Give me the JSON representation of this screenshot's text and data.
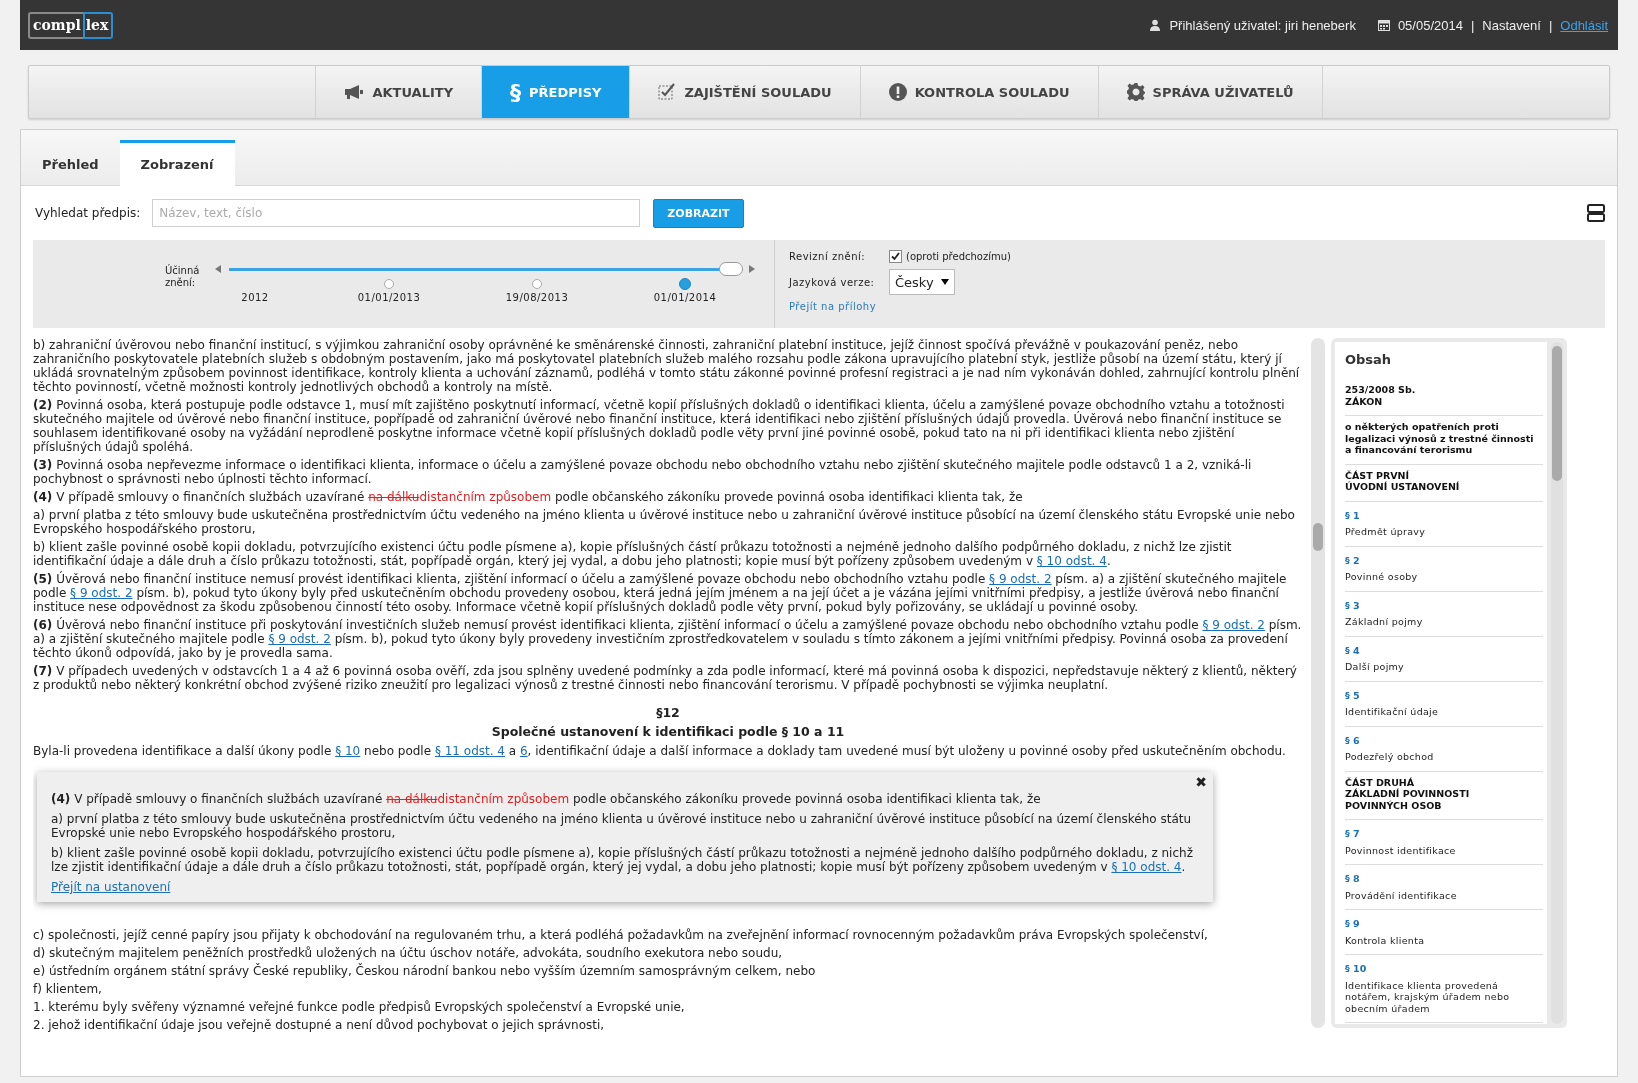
{
  "header": {
    "logo": [
      "compl",
      "lex"
    ],
    "user_label": "Přihlášený uživatel: jiri heneberk",
    "date": "05/05/2014",
    "separator_1": "|",
    "settings": "Nastavení",
    "separator_2": "|",
    "logout": "Odhlásit"
  },
  "nav": [
    {
      "label": "AKTUALITY",
      "kind": "megaphone",
      "selected": false
    },
    {
      "label": "PŘEDPISY",
      "kind": "symbol",
      "symbol": "§",
      "selected": true
    },
    {
      "label": "ZAJIŠTĚNÍ SOULADU",
      "kind": "check",
      "selected": false
    },
    {
      "label": "KONTROLA SOULADU",
      "kind": "alert",
      "selected": false
    },
    {
      "label": "SPRÁVA UŽIVATELŮ",
      "kind": "gear",
      "selected": false
    }
  ],
  "tabs": [
    {
      "label": "Přehled",
      "selected": false
    },
    {
      "label": "Zobrazení",
      "selected": true
    }
  ],
  "search": {
    "label": "Vyhledat předpis:",
    "placeholder": "Název, text, číslo",
    "button": "ZOBRAZIT"
  },
  "timeline": {
    "label": "Účinná znění:",
    "level": 1,
    "points": [
      {
        "label": "2012",
        "kind": "start"
      },
      {
        "label": "01/01/2013",
        "kind": "date",
        "selected": false
      },
      {
        "label": "19/08/2013",
        "kind": "date",
        "selected": false
      },
      {
        "label": "01/01/2014",
        "kind": "date",
        "selected": true
      }
    ]
  },
  "options": {
    "revision_label": "Revizní znění:",
    "revision_checked": true,
    "revision_note": "(oproti předchozímu)",
    "language_label": "Jazyková verze:",
    "language": "Česky",
    "attachments_link": "Přejít na přílohy"
  },
  "document": {
    "upper": [
      {
        "kind": "para",
        "segments": [
          {
            "kind": "text",
            "text": "b) zahraniční úvěrovou nebo finanční institucí, s výjimkou zahraniční osoby oprávněné ke směnárenské činnosti, zahraniční platební instituce, jejíž činnost spočívá převážně v poukazování peněz, nebo zahraničního poskytovatele platebních služeb s obdobným postavením, jako má poskytovatel platebních služeb malého rozsahu podle zákona upravujícího platební styk, jestliže působí na území státu, který jí ukládá srovnatelným způsobem povinnost identifikace, kontroly klienta a uchování záznamů, podléhá v tomto státu zákonné povinné profesní registraci a je nad ním vykonáván dohled, zahrnující kontrolu plnění těchto povinností, včetně možnosti kontroly jednotlivých obchodů a kontroly na místě."
          }
        ]
      },
      {
        "kind": "para",
        "segments": [
          {
            "kind": "text",
            "text": "**(2)** Povinná osoba, která postupuje podle odstavce 1, musí mít zajištěno poskytnutí informací, včetně kopií příslušných dokladů o identifikaci klienta, účelu a zamýšlené povaze obchodního vztahu a totožnosti skutečného majitele od úvěrové nebo finanční instituce, popřípadě od zahraniční úvěrové nebo finanční instituce, která identifikaci nebo zjištění příslušných údajů provedla. Úvěrová nebo finanční instituce se souhlasem identifikované osoby na vyžádání neprodleně poskytne informace včetně kopií příslušných dokladů podle věty první jiné povinné osobě, pokud tato na ni při identifikaci klienta nebo zjištění příslušných údajů spoléhá."
          }
        ]
      },
      {
        "kind": "para",
        "segments": [
          {
            "kind": "text",
            "text": "**(3)** Povinná osoba nepřevezme informace o identifikaci klienta, informace o účelu a zamýšlené povaze obchodu nebo obchodního vztahu nebo zjištění skutečného majitele podle odstavců 1 a 2, vzniká-li pochybnost o správnosti nebo úplnosti těchto informací."
          }
        ]
      },
      {
        "kind": "para",
        "segments": [
          {
            "kind": "text",
            "text": "**(4)** V případě smlouvy o finančních službách uzavírané "
          },
          {
            "kind": "deleted",
            "text": "na dálku"
          },
          {
            "kind": "inserted",
            "text": "distančním způsobem"
          },
          {
            "kind": "text",
            "text": " podle občanského zákoníku provede povinná osoba identifikaci klienta tak, že"
          }
        ]
      },
      {
        "kind": "para",
        "segments": [
          {
            "kind": "text",
            "text": "a) první platba z této smlouvy bude uskutečněna prostřednictvím účtu vedeného na jméno klienta u úvěrové instituce nebo u zahraniční úvěrové instituce působící na území členského státu Evropské unie nebo Evropského hospodářského prostoru,"
          }
        ]
      },
      {
        "kind": "para",
        "segments": [
          {
            "kind": "text",
            "text": "b) klient zašle povinné osobě kopii dokladu, potvrzujícího existenci účtu podle písmene a), kopie příslušných částí průkazu totožnosti a nejméně jednoho dalšího podpůrného dokladu, z nichž lze zjistit identifikační údaje a dále druh a číslo průkazu totožnosti, stát, popřípadě orgán, který jej vydal, a dobu jeho platnosti; kopie musí být pořízeny způsobem uvedeným v "
          },
          {
            "kind": "link",
            "text": "§ 10 odst. 4"
          },
          {
            "kind": "text",
            "text": "."
          }
        ]
      },
      {
        "kind": "para",
        "segments": [
          {
            "kind": "text",
            "text": "**(5)** Úvěrová nebo finanční instituce nemusí provést identifikaci klienta, zjištění informací o účelu a zamýšlené povaze obchodu nebo obchodního vztahu podle "
          },
          {
            "kind": "link",
            "text": "§ 9 odst. 2"
          },
          {
            "kind": "text",
            "text": " písm. a) a zjištění skutečného majitele podle "
          },
          {
            "kind": "link",
            "text": "§ 9 odst. 2"
          },
          {
            "kind": "text",
            "text": " písm. b), pokud tyto úkony byly před uskutečněním obchodu provedeny osobou, která jedná jejím jménem a na její účet a je vázána jejími vnitřními předpisy, a jestliže úvěrová nebo finanční instituce nese odpovědnost za škodu způsobenou činností této osoby. Informace včetně kopií příslušných dokladů podle věty první, pokud byly pořizovány, se ukládají u povinné osoby."
          }
        ]
      },
      {
        "kind": "para",
        "segments": [
          {
            "kind": "text",
            "text": "**(6)** Úvěrová nebo finanční instituce při poskytování investičních služeb nemusí provést identifikaci klienta, zjištění informací o účelu a zamýšlené povaze obchodu nebo obchodního vztahu podle "
          },
          {
            "kind": "link",
            "text": "§ 9 odst. 2"
          },
          {
            "kind": "text",
            "text": " písm. a) a zjištění skutečného majitele podle "
          },
          {
            "kind": "link",
            "text": "§ 9 odst. 2"
          },
          {
            "kind": "text",
            "text": " písm. b), pokud tyto úkony byly provedeny investičním zprostředkovatelem v souladu s tímto zákonem a jejími vnitřními předpisy. Povinná osoba za provedení těchto úkonů odpovídá, jako by je provedla sama."
          }
        ]
      },
      {
        "kind": "para",
        "segments": [
          {
            "kind": "text",
            "text": "**(7)** V případech uvedených v odstavcích 1 a 4 až 6 povinná osoba ověří, zda jsou splněny uvedené podmínky a zda podle informací, které má povinná osoba k dispozici, nepředstavuje některý z klientů, některý z produktů nebo některý konkrétní obchod zvýšené riziko zneužití pro legalizaci výnosů z trestné činnosti nebo financování terorismu. V případě pochybnosti se výjimka neuplatní."
          }
        ]
      },
      {
        "kind": "heading",
        "segments": [
          {
            "kind": "text",
            "text": "§12"
          }
        ]
      },
      {
        "kind": "heading",
        "segments": [
          {
            "kind": "text",
            "text": "Společné ustanovení k identifikaci podle § 10 a 11"
          }
        ]
      },
      {
        "kind": "para",
        "segments": [
          {
            "kind": "text",
            "text": "Byla-li provedena identifikace a další úkony podle "
          },
          {
            "kind": "link",
            "text": "§ 10"
          },
          {
            "kind": "text",
            "text": " nebo podle "
          },
          {
            "kind": "link",
            "text": "§ 11 odst. 4"
          },
          {
            "kind": "text",
            "text": " a "
          },
          {
            "kind": "link",
            "text": "6"
          },
          {
            "kind": "text",
            "text": ", identifikační údaje a další informace a doklady tam uvedené musí být uloženy u povinné osoby před uskutečněním obchodu."
          }
        ]
      }
    ],
    "lower": [
      {
        "segments": [
          {
            "kind": "text",
            "text": "c) společnosti, jejíž cenné papíry jsou přijaty k obchodování na regulovaném trhu, a která podléhá požadavkům na zveřejnění informací rovnocenným požadavkům práva Evropských společenství,"
          }
        ]
      },
      {
        "segments": [
          {
            "kind": "text",
            "text": "d) skutečným majitelem peněžních prostředků uložených na účtu úschov notáře, advokáta, soudního exekutora nebo soudu,"
          }
        ]
      },
      {
        "segments": [
          {
            "kind": "text",
            "text": "e) ústředním orgánem státní správy České republiky, Českou národní bankou nebo vyšším územním samosprávným celkem, nebo"
          }
        ]
      },
      {
        "segments": [
          {
            "kind": "text",
            "text": "f) klientem,"
          }
        ]
      },
      {
        "segments": [
          {
            "kind": "text",
            "text": "1. kterému byly svěřeny významné veřejné funkce podle předpisů Evropských společenství a Evropské unie,"
          }
        ]
      },
      {
        "segments": [
          {
            "kind": "text",
            "text": "2. jehož identifikační údaje jsou veřejně dostupné a není důvod pochybovat o jejich správnosti,"
          }
        ]
      }
    ]
  },
  "popup": {
    "close": "✖",
    "paragraphs": [
      {
        "segments": [
          {
            "kind": "text",
            "text": "**(4)** V případě smlouvy o finančních službách uzavírané "
          },
          {
            "kind": "deleted",
            "text": "na dálku"
          },
          {
            "kind": "inserted",
            "text": "distančním způsobem"
          },
          {
            "kind": "text",
            "text": " podle občanského zákoníku provede povinná osoba identifikaci klienta tak, že"
          }
        ]
      },
      {
        "segments": [
          {
            "kind": "text",
            "text": "a) první platba z této smlouvy bude uskutečněna prostřednictvím účtu vedeného na jméno klienta u úvěrové instituce nebo u zahraniční úvěrové instituce působící na území členského státu Evropské unie nebo Evropského hospodářského prostoru,"
          }
        ]
      },
      {
        "segments": [
          {
            "kind": "text",
            "text": "b) klient zašle povinné osobě kopii dokladu, potvrzujícího existenci účtu podle písmene a), kopie příslušných částí průkazu totožnosti a nejméně jednoho dalšího podpůrného dokladu, z nichž lze zjistit identifikační údaje a dále druh a číslo průkazu totožnosti, stát, popřípadě orgán, který jej vydal, a dobu jeho platnosti; kopie musí být pořízeny způsobem uvedeným v "
          },
          {
            "kind": "link",
            "text": "§ 10 odst. 4"
          },
          {
            "kind": "text",
            "text": "."
          }
        ]
      }
    ],
    "link": "Přejít na ustanovení"
  },
  "toc": {
    "title": "Obsah",
    "items": [
      {
        "kind": "heading",
        "text": "253/2008 Sb.\nZÁKON"
      },
      {
        "kind": "heading",
        "text": "o některých opatřeních proti legalizaci výnosů z trestné činnosti a financování terorismu"
      },
      {
        "kind": "heading",
        "text": "ČÁST PRVNÍ\nÚVODNÍ USTANOVENÍ"
      },
      {
        "kind": "section",
        "number": "§ 1",
        "title": "Předmět úpravy"
      },
      {
        "kind": "section",
        "number": "§ 2",
        "title": "Povinné osoby"
      },
      {
        "kind": "section",
        "number": "§ 3",
        "title": "Základní pojmy"
      },
      {
        "kind": "section",
        "number": "§ 4",
        "title": "Další pojmy"
      },
      {
        "kind": "section",
        "number": "§ 5",
        "title": "Identifikační údaje"
      },
      {
        "kind": "section",
        "number": "§ 6",
        "title": "Podezřelý obchod"
      },
      {
        "kind": "heading",
        "text": "ČÁST DRUHÁ\nZÁKLADNÍ POVINNOSTI\nPOVINNÝCH OSOB"
      },
      {
        "kind": "section",
        "number": "§ 7",
        "title": "Povinnost identifikace"
      },
      {
        "kind": "section",
        "number": "§ 8",
        "title": "Provádění identifikace"
      },
      {
        "kind": "section",
        "number": "§ 9",
        "title": "Kontrola klienta"
      },
      {
        "kind": "section",
        "number": "§ 10",
        "title": "Identifikace klienta provedená notářem, krajským úřadem nebo obecním úřadem"
      }
    ]
  }
}
